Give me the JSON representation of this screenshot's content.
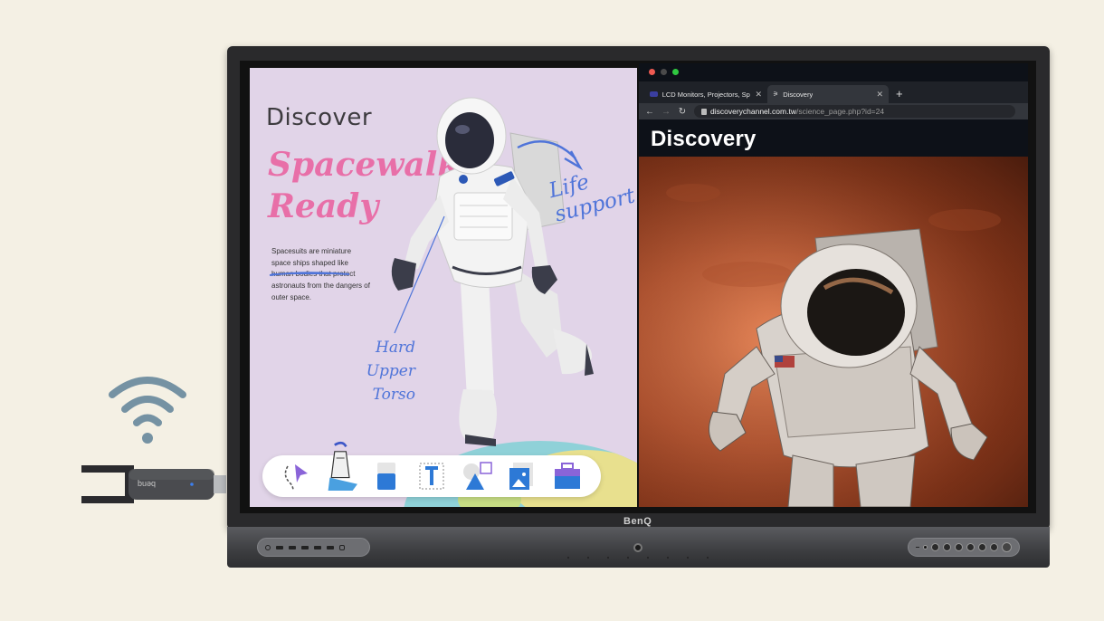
{
  "monitor": {
    "brand": "BenQ"
  },
  "dongle": {
    "label": "benq"
  },
  "whiteboard": {
    "eyebrow": "Discover",
    "headline_line1": "Spacewalk",
    "headline_line2": "Ready",
    "body_before": "Spacesuits are miniature space ships shaped like ",
    "body_underlined": "human bodies that",
    "body_after": " protect astronauts from the dangers of outer space.",
    "note_life_line1": "Life",
    "note_life_line2": "support",
    "note_hut_line1": "Hard Upper",
    "note_hut_line2": "Torso",
    "pink": "#e86fa8",
    "pen_blue": "#4f74d9",
    "tools": [
      "lasso-select",
      "pen",
      "eraser",
      "text",
      "shapes",
      "image",
      "toolbox"
    ]
  },
  "browser": {
    "tabs": [
      {
        "label": "LCD Monitors, Projectors, Spe",
        "active": false
      },
      {
        "label": "Discovery",
        "active": true
      }
    ],
    "url_domain": "discoverychannel.com.tw",
    "url_path": "/science_page.php?id=24",
    "site_logo": "Discovery"
  }
}
